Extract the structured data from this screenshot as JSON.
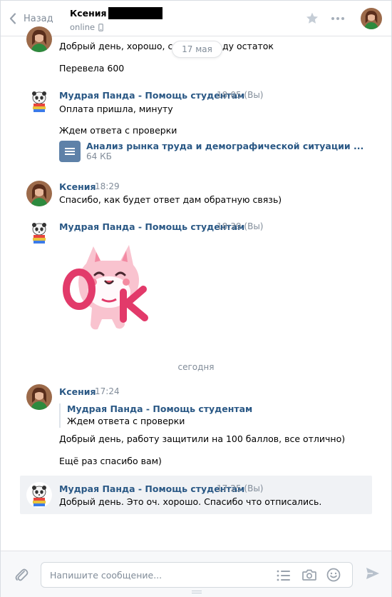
{
  "header": {
    "back_label": "Назад",
    "peer_name": "Ксения",
    "peer_status": "online"
  },
  "date_pill": "17 мая",
  "messages": {
    "m0_text1": "Добрый день, хорошо, сей",
    "m0_text1_tail": "ду остаток",
    "m0_text2": "Перевела 600",
    "m1_author": "Мудрая Панда - Помощь студентам",
    "m1_time": "18:05",
    "m1_you": "(Вы)",
    "m1_text1": "Оплата пришла, минуту",
    "m1_text2": "Ждем ответа с проверки",
    "m1_doc_title": "Анализ рынка труда и демографической ситуации ...",
    "m1_doc_size": "64 КБ",
    "m2_author": "Ксения",
    "m2_time": "18:29",
    "m2_text": "Спасибо, как будет ответ дам обратную связь)",
    "m3_author": "Мудрая Панда - Помощь студентам",
    "m3_time": "18:39",
    "m3_you": "(Вы)",
    "day_separator": "сегодня",
    "m4_author": "Ксения",
    "m4_time": "17:24",
    "m4_quote_author": "Мудрая Панда - Помощь студентам",
    "m4_quote_text": "Ждем ответа с проверки",
    "m4_text1": "Добрый день, работу защитили на 100 баллов, все отлично)",
    "m4_text2": "Ещё раз спасибо вам)",
    "m5_author": "Мудрая Панда - Помощь студентам",
    "m5_time": "17:25",
    "m5_you": "(Вы)",
    "m5_text": "Добрый день. Это оч. хорошо. Спасибо что отписались."
  },
  "sticker_text": "OK",
  "composer": {
    "placeholder": "Напишите сообщение..."
  },
  "icons": [
    "chevron-left-icon",
    "phone-icon",
    "star-icon",
    "more-icon",
    "document-icon",
    "paperclip-icon",
    "list-icon",
    "camera-icon",
    "smile-icon",
    "send-icon"
  ],
  "colors": {
    "link": "#2a5885",
    "muted": "#818c99",
    "selected_bg": "#f0f2f5",
    "doc_icon": "#5e81a8"
  }
}
